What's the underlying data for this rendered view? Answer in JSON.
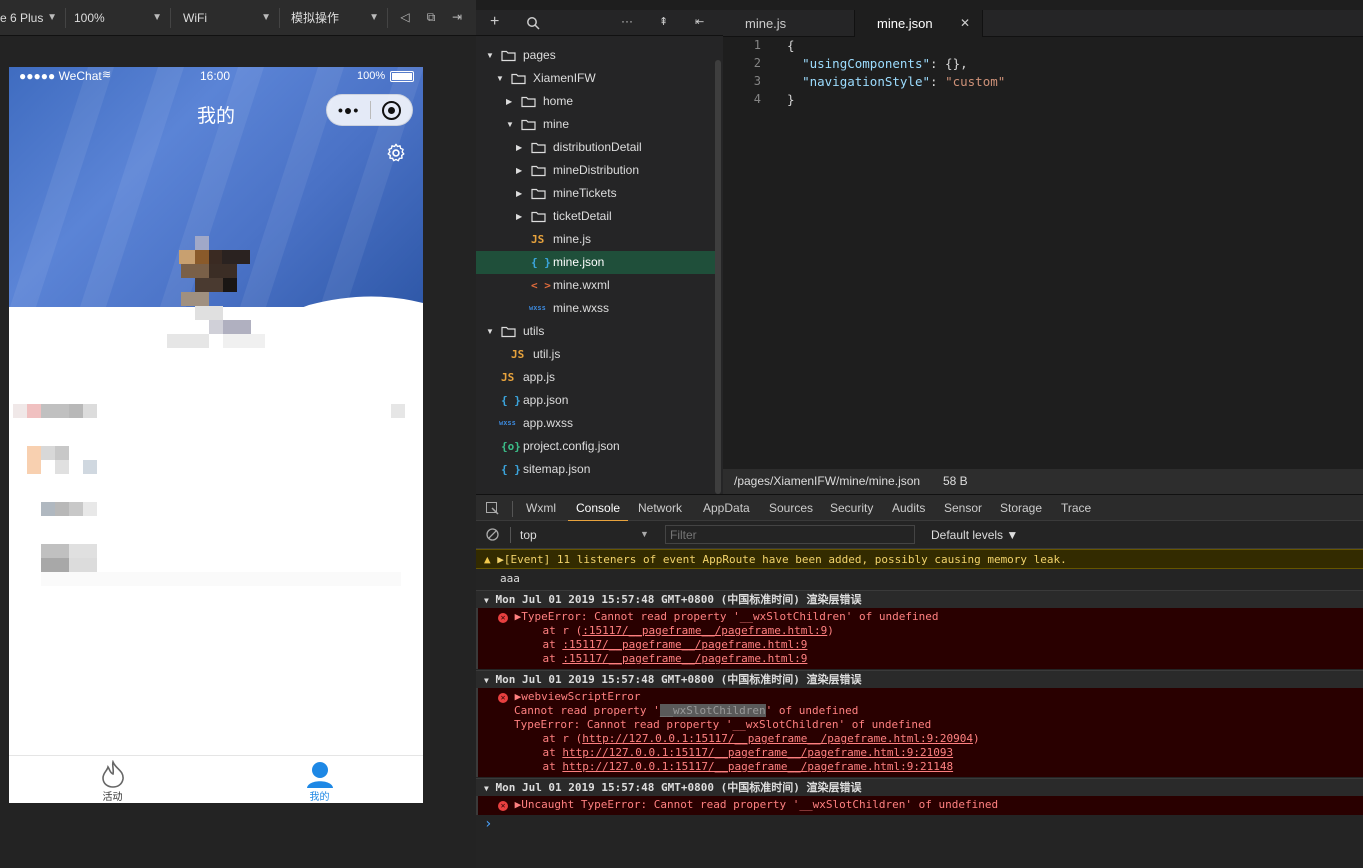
{
  "toolbar": {
    "device": "e 6 Plus",
    "zoom": "100%",
    "network": "WiFi",
    "operation": "模拟操作"
  },
  "phone": {
    "status": {
      "carrier": "●●●●● WeChat",
      "time": "16:00",
      "battery": "100%"
    },
    "nav_title": "我的",
    "tabs": [
      {
        "label": "活动",
        "color": "#333333"
      },
      {
        "label": "我的",
        "color": "#1e88e5"
      }
    ]
  },
  "tree": {
    "items": [
      {
        "label": "pages",
        "depth": 0,
        "kind": "folder",
        "open": true
      },
      {
        "label": "XiamenIFW",
        "depth": 1,
        "kind": "folder",
        "open": true
      },
      {
        "label": "home",
        "depth": 2,
        "kind": "folder",
        "open": false
      },
      {
        "label": "mine",
        "depth": 2,
        "kind": "folder",
        "open": true
      },
      {
        "label": "distributionDetail",
        "depth": 3,
        "kind": "folder",
        "open": false
      },
      {
        "label": "mineDistribution",
        "depth": 3,
        "kind": "folder",
        "open": false
      },
      {
        "label": "mineTickets",
        "depth": 3,
        "kind": "folder",
        "open": false
      },
      {
        "label": "ticketDetail",
        "depth": 3,
        "kind": "folder",
        "open": false
      },
      {
        "label": "mine.js",
        "depth": 3,
        "kind": "js"
      },
      {
        "label": "mine.json",
        "depth": 3,
        "kind": "json",
        "selected": true
      },
      {
        "label": "mine.wxml",
        "depth": 3,
        "kind": "wxml"
      },
      {
        "label": "mine.wxss",
        "depth": 3,
        "kind": "wxss"
      },
      {
        "label": "utils",
        "depth": 0,
        "kind": "folder",
        "open": true
      },
      {
        "label": "util.js",
        "depth": 1,
        "kind": "js"
      },
      {
        "label": "app.js",
        "depth": 0,
        "kind": "js"
      },
      {
        "label": "app.json",
        "depth": 0,
        "kind": "json"
      },
      {
        "label": "app.wxss",
        "depth": 0,
        "kind": "wxss"
      },
      {
        "label": "project.config.json",
        "depth": 0,
        "kind": "config"
      },
      {
        "label": "sitemap.json",
        "depth": 0,
        "kind": "json"
      }
    ]
  },
  "editor": {
    "tabs": [
      "mine.js",
      "mine.json"
    ],
    "lines": [
      {
        "n": "1",
        "parts": [
          [
            "p",
            "{"
          ]
        ]
      },
      {
        "n": "2",
        "parts": [
          [
            "p",
            "  "
          ],
          [
            "k",
            "\"usingComponents\""
          ],
          [
            "p",
            ": {},"
          ]
        ]
      },
      {
        "n": "3",
        "parts": [
          [
            "p",
            "  "
          ],
          [
            "k",
            "\"navigationStyle\""
          ],
          [
            "p",
            ": "
          ],
          [
            "s",
            "\"custom\""
          ]
        ]
      },
      {
        "n": "4",
        "parts": [
          [
            "p",
            "}"
          ]
        ]
      }
    ],
    "path": "/pages/XiamenIFW/mine/mine.json",
    "size": "58 B"
  },
  "devtools": {
    "tabs": [
      "Wxml",
      "Console",
      "Network",
      "AppData",
      "Sources",
      "Security",
      "Audits",
      "Sensor",
      "Storage",
      "Trace"
    ],
    "active": "Console",
    "context": "top",
    "filter_placeholder": "Filter",
    "levels": "Default levels ▼"
  },
  "console": {
    "warn": "▶[Event] 11 listeners of event AppRoute have been added, possibly causing memory leak.",
    "log": "aaa",
    "group1": "Mon Jul 01 2019 15:57:48 GMT+0800 (中国标准时间) 渲染层错误",
    "e1": "▶TypeError: Cannot read property '__wxSlotChildren' of undefined",
    "e1_s1a": "    at r (",
    "e1_s1b": ":15117/__pageframe__/pageframe.html:9",
    "e1_s1c": ")",
    "e1_s2a": "    at ",
    "e1_s2b": ":15117/__pageframe__/pageframe.html:9",
    "e1_s3a": "    at ",
    "e1_s3b": ":15117/__pageframe__/pageframe.html:9",
    "group2": "Mon Jul 01 2019 15:57:48 GMT+0800 (中国标准时间) 渲染层错误",
    "e2": "▶webviewScriptError",
    "e2_l1a": "Cannot read property '",
    "e2_l1b": "__wxSlotChildren",
    "e2_l1c": "' of undefined",
    "e2_l2": "TypeError: Cannot read property '__wxSlotChildren' of undefined",
    "e2_s1a": "    at r (",
    "e2_s1b": "http://127.0.0.1:15117/__pageframe__/pageframe.html:9:20904",
    "e2_s1c": ")",
    "e2_s2a": "    at ",
    "e2_s2b": "http://127.0.0.1:15117/__pageframe__/pageframe.html:9:21093",
    "e2_s3a": "    at ",
    "e2_s3b": "http://127.0.0.1:15117/__pageframe__/pageframe.html:9:21148",
    "group3": "Mon Jul 01 2019 15:57:48 GMT+0800 (中国标准时间) 渲染层错误",
    "e3": "▶Uncaught TypeError: Cannot read property '__wxSlotChildren' of undefined",
    "prompt": "›"
  },
  "colors": {
    "accent": "#e8a33d",
    "selected_row": "#1f4f3a",
    "error_bg": "#290000",
    "error_text": "#ff8080",
    "warn_bg": "#332b00"
  }
}
